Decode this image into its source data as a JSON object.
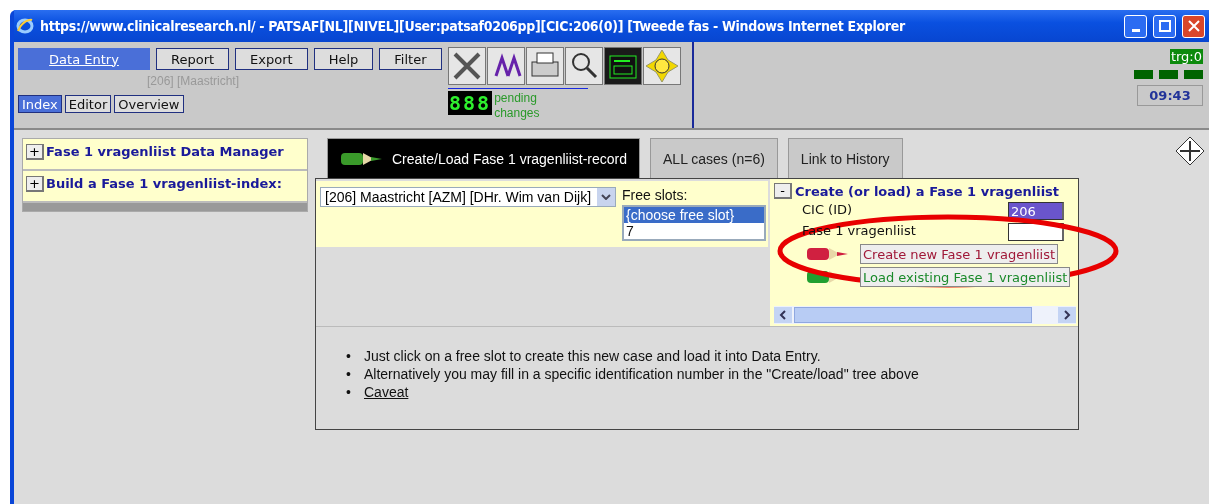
{
  "window": {
    "title": "https://www.clinicalresearch.nl/ - PATSAF[NL][NIVEL][User:patsaf0206pp][CIC:206(0)] [Tweede fas - Windows Internet Explorer"
  },
  "menu": [
    {
      "label": "Data Entry",
      "selected": true
    },
    {
      "label": "Report",
      "selected": false
    },
    {
      "label": "Export",
      "selected": false
    },
    {
      "label": "Help",
      "selected": false
    },
    {
      "label": "Filter",
      "selected": false
    }
  ],
  "site_label": "[206] [Maastricht]",
  "view_tabs": [
    {
      "label": "Index",
      "selected": true
    },
    {
      "label": "Editor",
      "selected": false
    },
    {
      "label": "Overview",
      "selected": false
    }
  ],
  "pending": {
    "counter": "888",
    "label": "pending changes"
  },
  "status": {
    "trigger": "trg:0",
    "time": "09:43"
  },
  "tree": [
    {
      "toggle": "+",
      "label": "Fase 1 vragenliist Data Manager",
      "expanded": false
    },
    {
      "toggle": "+",
      "label": "Build a Fase 1 vragenliist-index:",
      "expanded": false
    }
  ],
  "tabs": [
    {
      "label": "Create/Load Fase 1 vragenliist-record",
      "selected": true
    },
    {
      "label": "ALL cases (n=6)",
      "selected": false
    },
    {
      "label": "Link to History",
      "selected": false
    }
  ],
  "site_select": {
    "value": "[206] Maastricht [AZM] [DHr. Wim van Dijk]"
  },
  "free_slots": {
    "label": "Free slots:",
    "options": [
      {
        "label": "{choose free slot}",
        "selected": true
      },
      {
        "label": "7",
        "selected": false
      }
    ]
  },
  "create_panel": {
    "toggle": "-",
    "title": "Create (or load) a Fase 1 vragenliist",
    "expanded": true,
    "fields": [
      {
        "label": "CIC (ID)",
        "value": "206",
        "highlighted": true
      },
      {
        "label": "Fase 1 vragenliist",
        "highlighted": false
      }
    ],
    "actions": [
      {
        "label": "Create new Fase 1 vragenliist",
        "kind": "create"
      },
      {
        "label": "Load existing Fase 1 vragenliist",
        "kind": "load"
      }
    ]
  },
  "help": [
    {
      "marker": "•",
      "text": "Just click on a free slot to create this new case and load it into Data Entry."
    },
    {
      "marker": "•",
      "text": "Alternatively you may fill in a specific identification number in the \"Create/load\" tree above"
    }
  ],
  "help_link": {
    "marker": "•",
    "text": "Caveat"
  }
}
